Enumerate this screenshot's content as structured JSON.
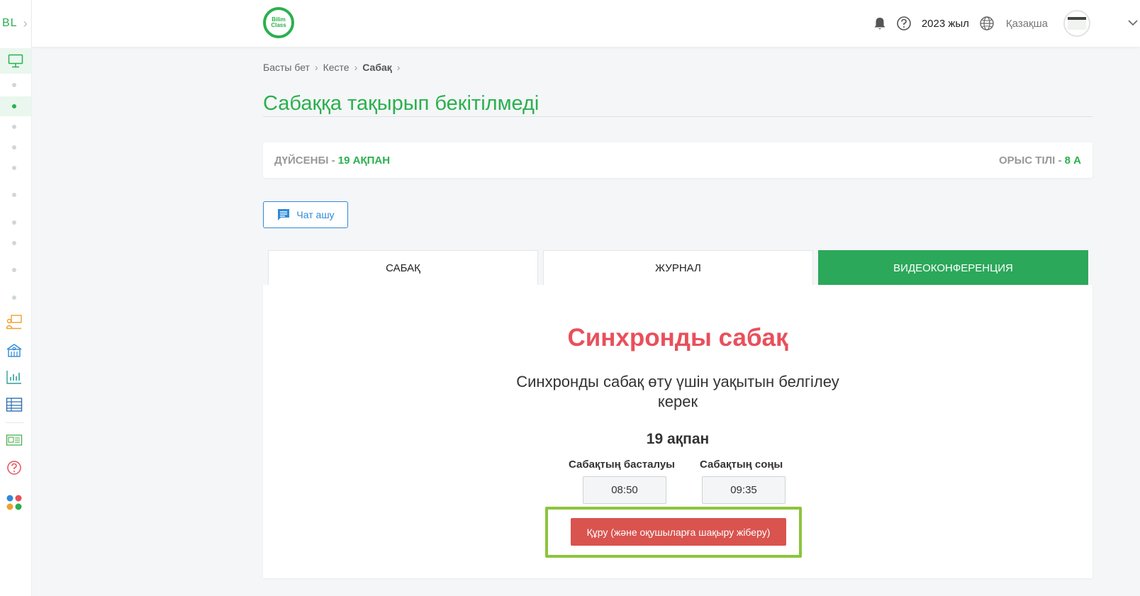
{
  "brand": {
    "text": "BL"
  },
  "logo": {
    "line1": "Bilim",
    "line2": "Class"
  },
  "header": {
    "year": "2023 жыл",
    "language": "Қазақша"
  },
  "breadcrumb": {
    "home": "Басты бет",
    "schedule": "Кесте",
    "current": "Сабақ"
  },
  "page": {
    "title": "Сабаққа тақырып бекітілмеді"
  },
  "info": {
    "day": "ДҮЙСЕНБІ - ",
    "date": "19 АҚПАН",
    "subject": "ОРЫС ТІЛІ - ",
    "class": "8 А"
  },
  "chat_button": {
    "label": "Чат ашу"
  },
  "tabs": [
    {
      "label": "САБАҚ"
    },
    {
      "label": "ЖУРНАЛ"
    },
    {
      "label": "ВИДЕОКОНФЕРЕНЦИЯ"
    }
  ],
  "panel": {
    "title": "Синхронды сабақ",
    "subtitle": "Синхронды сабақ өту үшін уақытын белгілеу керек",
    "date": "19 ақпан",
    "start_label": "Сабақтың басталуы",
    "end_label": "Сабақтың соңы",
    "start_time": "08:50",
    "end_time": "09:35",
    "create_button": "Құру (және оқушыларға шақыру жіберу)"
  },
  "colors": {
    "brand_green": "#2bb04d",
    "accent_red": "#e8505b",
    "button_red": "#d9534f",
    "highlight": "#8cc43c",
    "link_blue": "#2f8ad8"
  }
}
